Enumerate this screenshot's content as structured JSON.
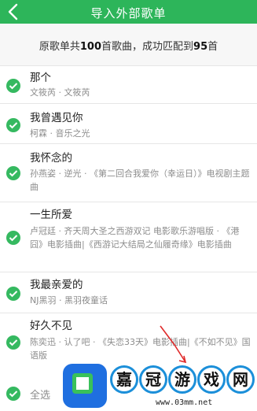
{
  "header": {
    "title": "导入外部歌单"
  },
  "summary": {
    "prefix": "原歌单共",
    "total": "100",
    "middle": "首歌曲，成功匹配到",
    "matched": "95",
    "suffix": "首"
  },
  "songs": [
    {
      "title": "那个",
      "subtitle": "文筱芮 · 文筱芮"
    },
    {
      "title": "我曾遇见你",
      "subtitle": "柯霖 · 音乐之光"
    },
    {
      "title": "我怀念的",
      "subtitle": "孙燕姿 · 逆光 · 《第二回合我爱你（幸运日）》电视剧主题曲"
    },
    {
      "title": "一生所爱",
      "subtitle": "卢冠廷 · 齐天周大圣之西游双记 电影歌乐游唱版 · 《港囧》电影插曲|《西游记大结局之仙履奇缘》电影插曲"
    },
    {
      "title": "我最亲爱的",
      "subtitle": "NJ黑羽 · 黑羽夜童话"
    },
    {
      "title": "好久不见",
      "subtitle": "陈奕迅 · 认了吧 · 《失恋33天》电影插曲|《不如不见》国语版"
    }
  ],
  "footer": {
    "select_all": "全选"
  },
  "watermark": {
    "chars": [
      "嘉",
      "冠",
      "游",
      "戏",
      "网"
    ],
    "url": "www.03mm.net"
  },
  "colors": {
    "header_bg": "#2db55a",
    "check": "#35b960",
    "summary_bg": "#f7f7f7"
  },
  "icons": {
    "back": "chevron-left-icon",
    "check": "check-circle-icon"
  }
}
